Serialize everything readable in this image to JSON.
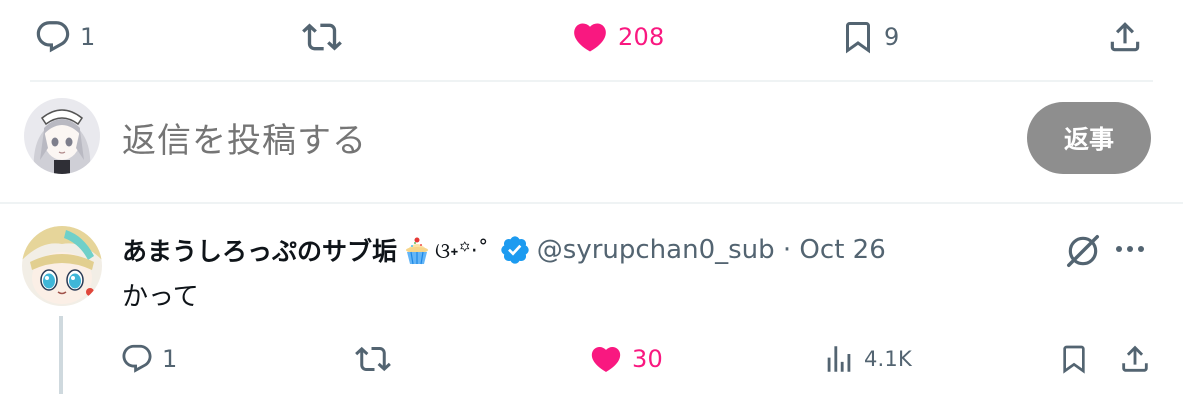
{
  "main_post_actions": {
    "reply_count": "1",
    "retweet_count": "",
    "like_count": "208",
    "bookmark_count": "9"
  },
  "reply_composer": {
    "placeholder": "返信を投稿する",
    "reply_button_label": "返事"
  },
  "reply_tweet": {
    "display_name": "あまうしろっぷのサブ垢",
    "kaomoji": "ଓ˖꙳·˚",
    "handle_and_date": "@syrupchan0_sub · Oct 26",
    "text": "かって",
    "actions": {
      "reply_count": "1",
      "like_count": "30",
      "views_count": "4.1K"
    }
  },
  "colors": {
    "like_pink": "#f91880",
    "muted_gray": "#536471",
    "verified_blue": "#1d9bf0",
    "reply_button_bg": "#8e8e8e",
    "divider": "#eff3f4"
  },
  "icons": [
    "reply-icon",
    "retweet-icon",
    "heart-filled-icon",
    "bookmark-icon",
    "share-icon",
    "views-icon",
    "verified-badge-icon",
    "grok-icon",
    "more-icon",
    "cupcake-emoji-icon"
  ]
}
